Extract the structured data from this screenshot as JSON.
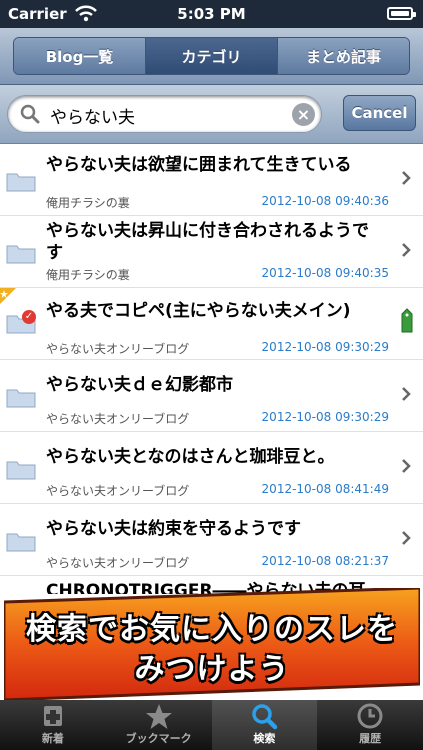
{
  "status": {
    "carrier": "Carrier",
    "time": "5:03 PM"
  },
  "tabs_top": [
    {
      "label": "Blog一覧"
    },
    {
      "label": "カテゴリ"
    },
    {
      "label": "まとめ記事"
    }
  ],
  "search": {
    "value": "やらない夫",
    "cancel_label": "Cancel"
  },
  "rows": [
    {
      "title": "やらない夫は欲望に囲まれて生きている",
      "source": "俺用チラシの裏",
      "date": "2012-10-08 09:40:36"
    },
    {
      "title": "やらない夫は昇山に付き合わされるようです",
      "source": "俺用チラシの裏",
      "date": "2012-10-08 09:40:35"
    },
    {
      "title": "やる夫でコピペ(主にやらない夫メイン)",
      "source": "やらない夫オンリーブログ",
      "date": "2012-10-08 09:30:29"
    },
    {
      "title": "やらない夫ｄｅ幻影都市",
      "source": "やらない夫オンリーブログ",
      "date": "2012-10-08 09:30:29"
    },
    {
      "title": "やらない夫となのはさんと珈琲豆と。",
      "source": "やらない夫オンリーブログ",
      "date": "2012-10-08 08:41:49"
    },
    {
      "title": "やらない夫は約束を守るようです",
      "source": "やらない夫オンリーブログ",
      "date": "2012-10-08 08:21:37"
    },
    {
      "title": "CHRONOTRIGGER――やらない夫の耳"
    }
  ],
  "banner": {
    "line1": "検索でお気に入りのスレを",
    "line2": "みつけよう"
  },
  "tabbar": [
    {
      "label": "新着",
      "icon": "new-icon"
    },
    {
      "label": "ブックマーク",
      "icon": "star-icon"
    },
    {
      "label": "検索",
      "icon": "search-icon"
    },
    {
      "label": "履歴",
      "icon": "clock-icon"
    }
  ]
}
